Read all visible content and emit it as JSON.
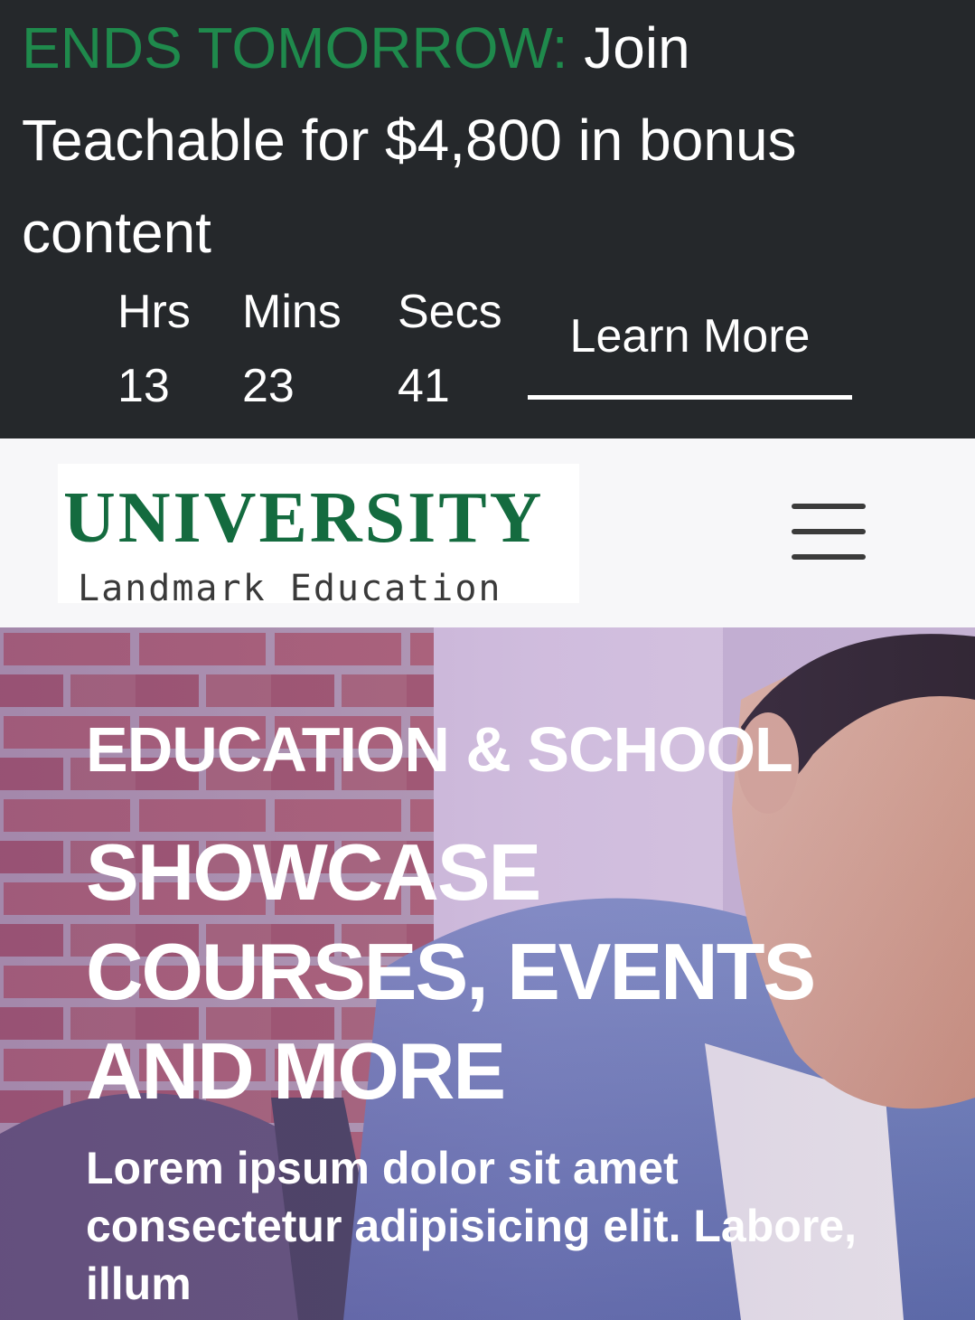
{
  "promo": {
    "highlight": "ENDS TOMORROW:",
    "message": " Join Teachable for $4,800 in bonus content",
    "countdown": {
      "hours_label": "Hrs",
      "hours_value": "13",
      "minutes_label": "Mins",
      "minutes_value": "23",
      "seconds_label": "Secs",
      "seconds_value": "41"
    },
    "cta_label": "Learn More",
    "colors": {
      "background": "#25282b",
      "highlight": "#1f8a4c"
    }
  },
  "header": {
    "logo": {
      "title": "UNIVERSITY",
      "subtitle": "Landmark Education",
      "color": "#146b3f"
    },
    "menu_icon": "hamburger-menu-icon"
  },
  "hero": {
    "kicker": "EDUCATION & SCHOOL",
    "title": "SHOWCASE COURSES, EVENTS AND MORE",
    "description": "Lorem ipsum dolor sit amet consectetur adipisicing elit. Labore, illum"
  }
}
